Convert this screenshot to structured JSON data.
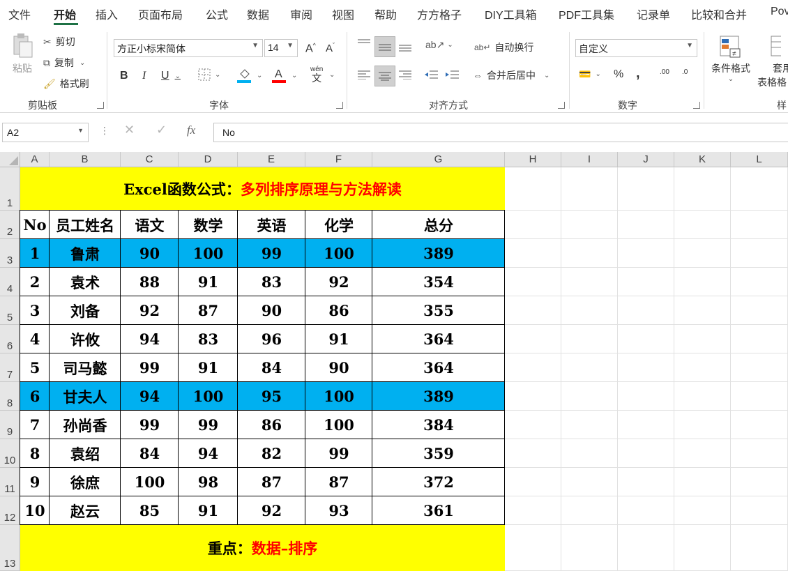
{
  "menu": {
    "tabs": [
      "文件",
      "开始",
      "插入",
      "页面布局",
      "公式",
      "数据",
      "审阅",
      "视图",
      "帮助",
      "方方格子",
      "DIY工具箱",
      "PDF工具集",
      "记录单",
      "比较和合并",
      "Pov"
    ],
    "active": "开始"
  },
  "ribbon": {
    "clipboard": {
      "paste": "粘贴",
      "cut": "剪切",
      "copy": "复制",
      "format_painter": "格式刷",
      "label": "剪贴板"
    },
    "font": {
      "font_name": "方正小标宋简体",
      "font_size": "14",
      "label": "字体",
      "bold": "B",
      "italic": "I",
      "underline": "U",
      "wen": "wén",
      "wen_char": "文"
    },
    "alignment": {
      "wrap": "自动换行",
      "merge": "合并后居中",
      "label": "对齐方式"
    },
    "number": {
      "format": "自定义",
      "label": "数字",
      "percent": "%",
      "comma": ",",
      "inc": ".00",
      "dec": ".0"
    },
    "styles": {
      "conditional": "条件格式",
      "table1": "套用",
      "table2": "表格格",
      "label": "样"
    }
  },
  "formula_bar": {
    "cell_ref": "A2",
    "value": "No",
    "fx": "fx"
  },
  "columns": [
    "A",
    "B",
    "C",
    "D",
    "E",
    "F",
    "G",
    "H",
    "I",
    "J",
    "K",
    "L"
  ],
  "rows": [
    "1",
    "2",
    "3",
    "4",
    "5",
    "6",
    "7",
    "8",
    "9",
    "10",
    "11",
    "12",
    "13"
  ],
  "sheet": {
    "title_black": "Excel函数公式：",
    "title_red": "多列排序原理与方法解读",
    "headers": [
      "No",
      "员工姓名",
      "语文",
      "数学",
      "英语",
      "化学",
      "总分"
    ],
    "data": [
      [
        "1",
        "鲁肃",
        "90",
        "100",
        "99",
        "100",
        "389"
      ],
      [
        "2",
        "袁术",
        "88",
        "91",
        "83",
        "92",
        "354"
      ],
      [
        "3",
        "刘备",
        "92",
        "87",
        "90",
        "86",
        "355"
      ],
      [
        "4",
        "许攸",
        "94",
        "83",
        "96",
        "91",
        "364"
      ],
      [
        "5",
        "司马懿",
        "99",
        "91",
        "84",
        "90",
        "364"
      ],
      [
        "6",
        "甘夫人",
        "94",
        "100",
        "95",
        "100",
        "389"
      ],
      [
        "7",
        "孙尚香",
        "99",
        "99",
        "86",
        "100",
        "384"
      ],
      [
        "8",
        "袁绍",
        "84",
        "94",
        "82",
        "99",
        "359"
      ],
      [
        "9",
        "徐庶",
        "100",
        "98",
        "87",
        "87",
        "372"
      ],
      [
        "10",
        "赵云",
        "85",
        "91",
        "92",
        "93",
        "361"
      ]
    ],
    "highlight_rows": [
      0,
      5
    ],
    "footer_black": "重点：",
    "footer_red": "数据–排序"
  },
  "colors": {
    "title_fill": "#ffff00",
    "highlight_fill": "#00b0f0",
    "accent": "#1e7145",
    "red_text": "#ff0000"
  }
}
